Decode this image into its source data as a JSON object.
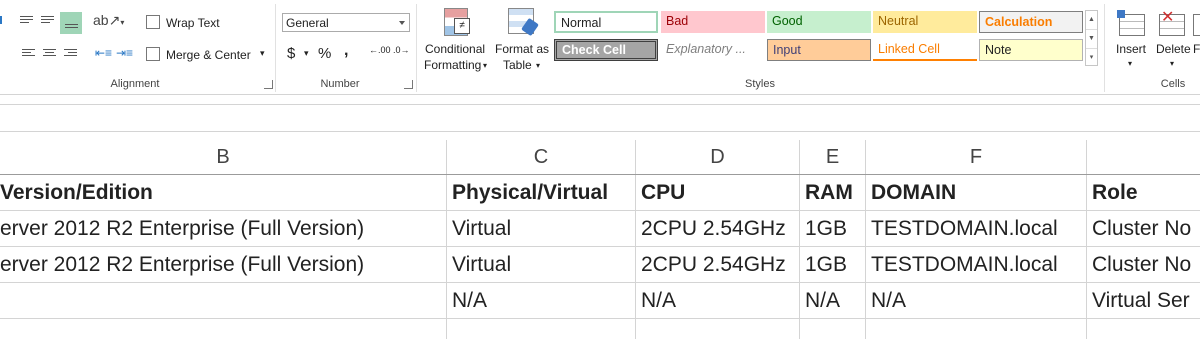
{
  "ribbon": {
    "alignment": {
      "wrap_text": "Wrap Text",
      "merge_center": "Merge & Center",
      "group_label": "Alignment"
    },
    "number": {
      "format_value": "General",
      "currency": "$",
      "percent": "%",
      "comma": ",",
      "increase_decimal": ".00",
      "decrease_decimal": ".0",
      "group_label": "Number"
    },
    "styles": {
      "conditional_formatting_line1": "Conditional",
      "conditional_formatting_line2": "Formatting",
      "format_as_table_line1": "Format as",
      "format_as_table_line2": "Table",
      "gallery": [
        {
          "label": "Normal",
          "color": "#ffffff"
        },
        {
          "label": "Bad",
          "color": "#ffc7ce"
        },
        {
          "label": "Good",
          "color": "#c6efce"
        },
        {
          "label": "Neutral",
          "color": "#ffeb9c"
        },
        {
          "label": "Calculation",
          "color": "#f2f2f2"
        },
        {
          "label": "Check Cell",
          "color": "#a5a5a5"
        },
        {
          "label": "Explanatory ...",
          "color": "#ffffff"
        },
        {
          "label": "Input",
          "color": "#ffcc99"
        },
        {
          "label": "Linked Cell",
          "color": "#ffffff"
        },
        {
          "label": "Note",
          "color": "#ffffcc"
        }
      ],
      "group_label": "Styles"
    },
    "cells": {
      "insert": "Insert",
      "delete": "Delete",
      "format_partial": "F",
      "group_label": "Cells"
    }
  },
  "sheet": {
    "columns": [
      "B",
      "C",
      "D",
      "E",
      "F"
    ],
    "rows": [
      [
        "Version/Edition",
        "Physical/Virtual",
        "CPU",
        "RAM",
        "DOMAIN",
        "Role"
      ],
      [
        "erver 2012 R2 Enterprise (Full Version)",
        "Virtual",
        "2CPU 2.54GHz",
        "1GB",
        "TESTDOMAIN.local",
        "Cluster No"
      ],
      [
        "erver 2012 R2 Enterprise (Full Version)",
        "Virtual",
        "2CPU 2.54GHz",
        "1GB",
        "TESTDOMAIN.local",
        "Cluster No"
      ],
      [
        "",
        "N/A",
        "N/A",
        "N/A",
        "N/A",
        "Virtual Ser"
      ],
      [
        "",
        "",
        "",
        "",
        "",
        ""
      ]
    ]
  }
}
